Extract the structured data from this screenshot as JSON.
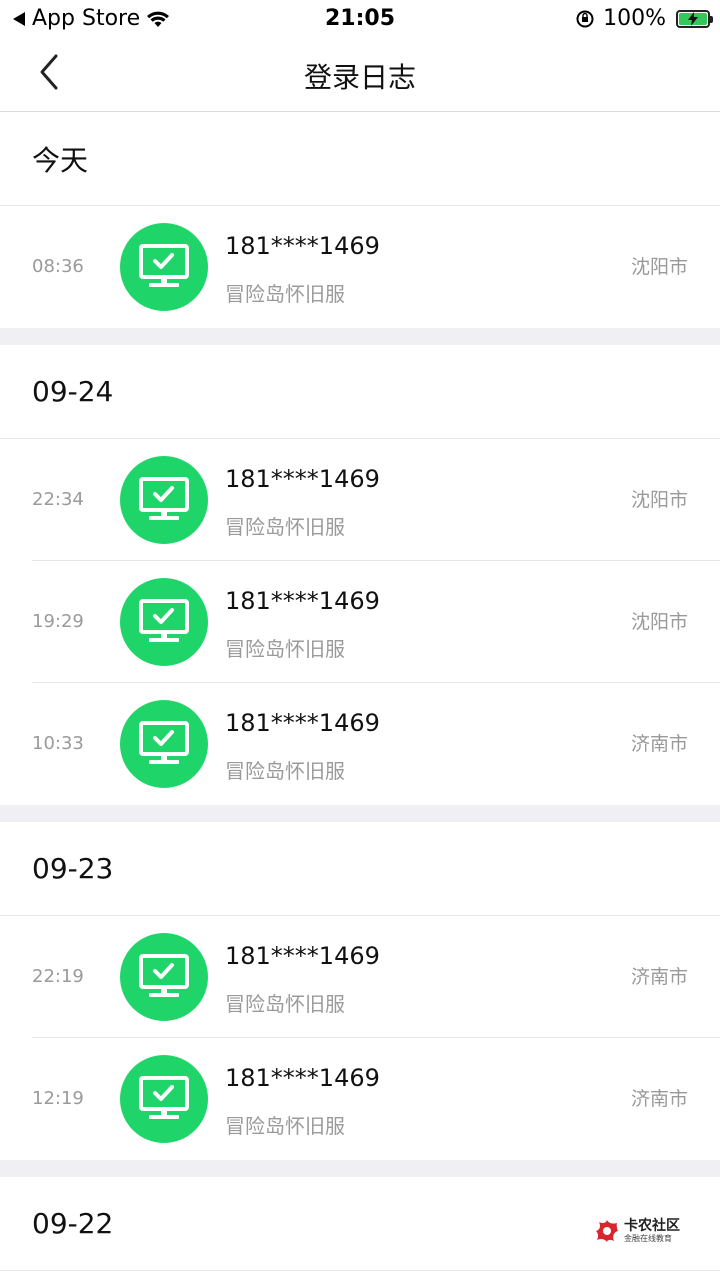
{
  "status_bar": {
    "back_app": "App Store",
    "time": "21:05",
    "battery": "100%"
  },
  "nav": {
    "title": "登录日志"
  },
  "groups": [
    {
      "date": "今天",
      "entries": [
        {
          "time": "08:36",
          "account": "181****1469",
          "game": "冒险岛怀旧服",
          "city": "沈阳市"
        }
      ]
    },
    {
      "date": "09-24",
      "entries": [
        {
          "time": "22:34",
          "account": "181****1469",
          "game": "冒险岛怀旧服",
          "city": "沈阳市"
        },
        {
          "time": "19:29",
          "account": "181****1469",
          "game": "冒险岛怀旧服",
          "city": "沈阳市"
        },
        {
          "time": "10:33",
          "account": "181****1469",
          "game": "冒险岛怀旧服",
          "city": "济南市"
        }
      ]
    },
    {
      "date": "09-23",
      "entries": [
        {
          "time": "22:19",
          "account": "181****1469",
          "game": "冒险岛怀旧服",
          "city": "济南市"
        },
        {
          "time": "12:19",
          "account": "181****1469",
          "game": "冒险岛怀旧服",
          "city": "济南市"
        }
      ]
    },
    {
      "date": "09-22",
      "entries": []
    }
  ],
  "watermark": {
    "title": "卡农社区",
    "subtitle": "金融在线教育"
  },
  "colors": {
    "accent": "#1fd56a",
    "separator": "#efeff4",
    "secondary_text": "#9a9a9a"
  },
  "icons": {
    "row": "computer-check-icon",
    "back": "chevron-left-icon"
  }
}
